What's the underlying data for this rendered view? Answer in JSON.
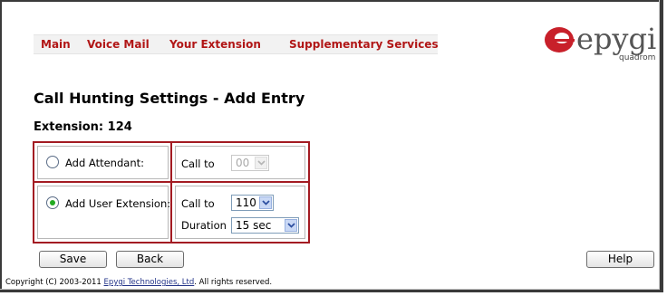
{
  "nav": {
    "items": [
      {
        "label": "Main"
      },
      {
        "label": "Voice Mail"
      },
      {
        "label": "Your Extension"
      },
      {
        "label": "Supplementary Services"
      }
    ]
  },
  "logo": {
    "brand": "epygi",
    "sub": "quadrom"
  },
  "page": {
    "title": "Call Hunting Settings - Add Entry",
    "extension_label": "Extension: 124"
  },
  "form": {
    "attendant": {
      "radio_label": "Add Attendant:",
      "selected": false,
      "call_to_label": "Call to",
      "call_to_value": "00",
      "disabled": true
    },
    "user_extension": {
      "radio_label": "Add User Extension:",
      "selected": true,
      "call_to_label": "Call to",
      "call_to_value": "110",
      "duration_label": "Duration",
      "duration_value": "15 sec"
    }
  },
  "buttons": {
    "save": "Save",
    "back": "Back",
    "help": "Help"
  },
  "footer": {
    "prefix": "Copyright (C) 2003-2011 ",
    "link": "Epygi Technologies, Ltd",
    "suffix": ". All rights reserved."
  },
  "colors": {
    "nav_text": "#b11616",
    "form_border": "#a31b22",
    "logo_red": "#c8202a"
  }
}
